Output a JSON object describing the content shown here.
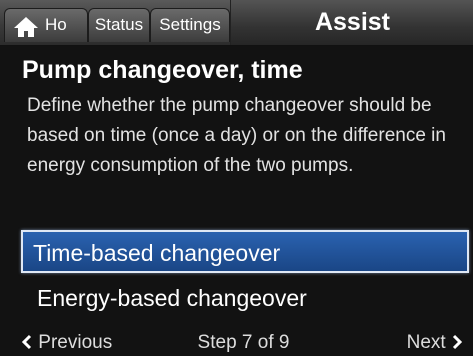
{
  "tabs": {
    "home": "Ho",
    "status": "Status",
    "settings": "Settings",
    "assist": "Assist"
  },
  "page": {
    "title": "Pump changeover, time",
    "description": "Define whether the pump changeover should be based on time (once a day) or on the difference in energy consumption of the two pumps."
  },
  "options": [
    {
      "label": "Time-based changeover",
      "selected": true
    },
    {
      "label": "Energy-based changeover",
      "selected": false
    }
  ],
  "navigation": {
    "previous": "Previous",
    "step": "Step 7 of 9",
    "next": "Next"
  },
  "icons": {
    "home": "home-icon",
    "previous": "chevron-left-icon",
    "next": "chevron-right-icon"
  },
  "colors": {
    "selection": "#1f4f96",
    "background": "#121212"
  }
}
